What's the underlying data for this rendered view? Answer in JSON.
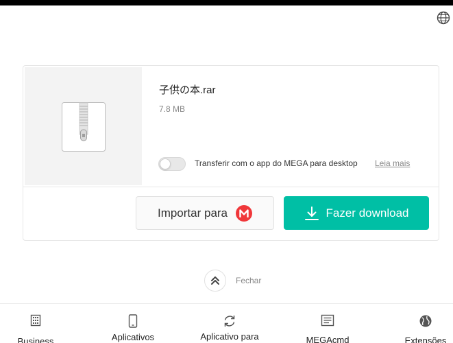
{
  "file": {
    "name": "子供の本.rar",
    "size": "7.8 MB"
  },
  "desktop_transfer": {
    "label": "Transferir com o app do MEGA para desktop",
    "learn_more": "Leia mais",
    "enabled": false
  },
  "actions": {
    "import_label": "Importar para",
    "download_label": "Fazer download"
  },
  "close_label": "Fechar",
  "footer": {
    "items": [
      {
        "label": "Business",
        "icon": "building-icon"
      },
      {
        "label": "Aplicativos",
        "icon": "mobile-phone-icon"
      },
      {
        "label": "Aplicativo para",
        "icon": "sync-icon"
      },
      {
        "label": "MEGAcmd",
        "icon": "terminal-icon"
      },
      {
        "label": "Extensões",
        "icon": "globe-icon"
      }
    ]
  },
  "colors": {
    "accent": "#00bfa5",
    "mega_red": "#f0373a"
  }
}
